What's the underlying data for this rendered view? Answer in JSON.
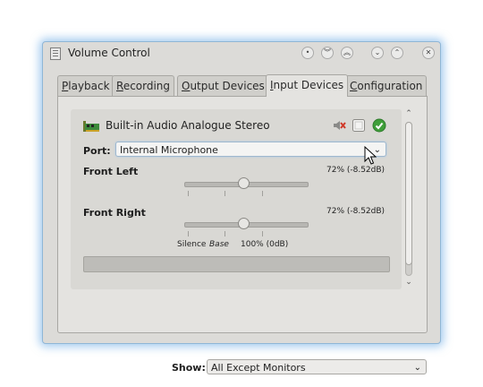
{
  "window": {
    "title": "Volume Control"
  },
  "tabs": [
    {
      "label": "Playback",
      "mnemonic": "P",
      "rest": "layback"
    },
    {
      "label": "Recording",
      "mnemonic": "R",
      "rest": "ecording"
    },
    {
      "label": "Output Devices",
      "mnemonic": "O",
      "rest": "utput Devices"
    },
    {
      "label": "Input Devices",
      "mnemonic": "I",
      "rest": "nput Devices",
      "active": true
    },
    {
      "label": "Configuration",
      "mnemonic": "C",
      "rest": "onfiguration"
    }
  ],
  "device": {
    "name": "Built-in Audio Analogue Stereo",
    "port_label": "Port:",
    "port_value": "Internal Microphone",
    "channels": [
      {
        "name": "Front Left",
        "value_text": "72% (-8.52dB)",
        "level": 0.72
      },
      {
        "name": "Front Right",
        "value_text": "72% (-8.52dB)",
        "level": 0.72
      }
    ],
    "scale": {
      "silence": "Silence",
      "base": "Base",
      "hundred": "100% (0dB)"
    },
    "peak_level": 0
  },
  "footer": {
    "show_label": "Show:",
    "show_value": "All Except Monitors"
  },
  "icons": {
    "app": "document-icon",
    "device": "sound-card-icon",
    "mute": "speaker-muted-icon",
    "lock": "lock-channels-icon",
    "default": "set-default-check-icon"
  },
  "colors": {
    "accent": "#8fb6d6",
    "check": "#3f9f3a"
  }
}
